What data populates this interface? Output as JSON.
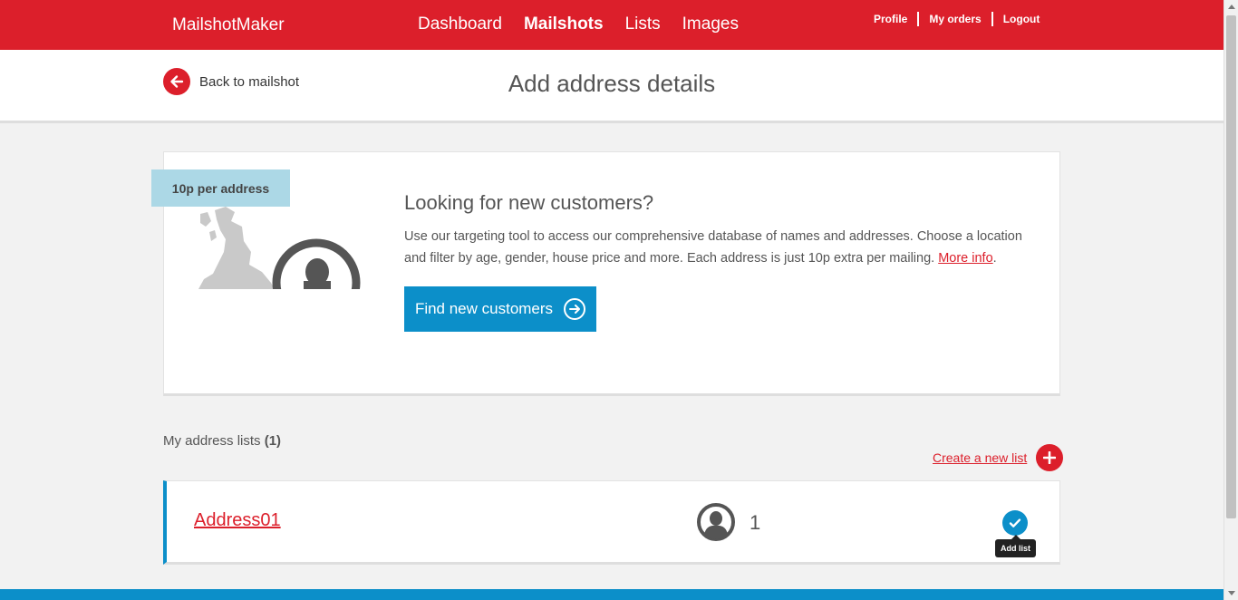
{
  "brand": "MailshotMaker",
  "nav": {
    "dashboard": "Dashboard",
    "mailshots": "Mailshots",
    "lists": "Lists",
    "images": "Images"
  },
  "user_nav": {
    "profile": "Profile",
    "orders": "My orders",
    "logout": "Logout"
  },
  "subheader": {
    "back_label": "Back to mailshot",
    "title": "Add address details"
  },
  "promo": {
    "price_tag": "10p per address",
    "title": "Looking for new customers?",
    "body": "Use our targeting tool to access our comprehensive database of names and addresses. Choose a location and filter by age, gender, house price and more. Each address is just 10p extra per mailing.",
    "more_info": "More info",
    "button_label": "Find new customers"
  },
  "address_lists": {
    "heading_label": "My address lists",
    "heading_count": "(1)",
    "create_label": "Create a new list",
    "items": [
      {
        "name": "Address01",
        "count": "1",
        "action_tooltip": "Add list"
      }
    ]
  },
  "colors": {
    "brand_red": "#dc1f2b",
    "accent_blue": "#0c8fc9",
    "tag_blue": "#acd8e6"
  },
  "icons": {
    "back": "arrow-left-circle-icon",
    "find": "arrow-right-circle-icon",
    "create": "plus-circle-icon",
    "avatar": "user-avatar-icon",
    "add": "checkmark-circle-icon"
  }
}
